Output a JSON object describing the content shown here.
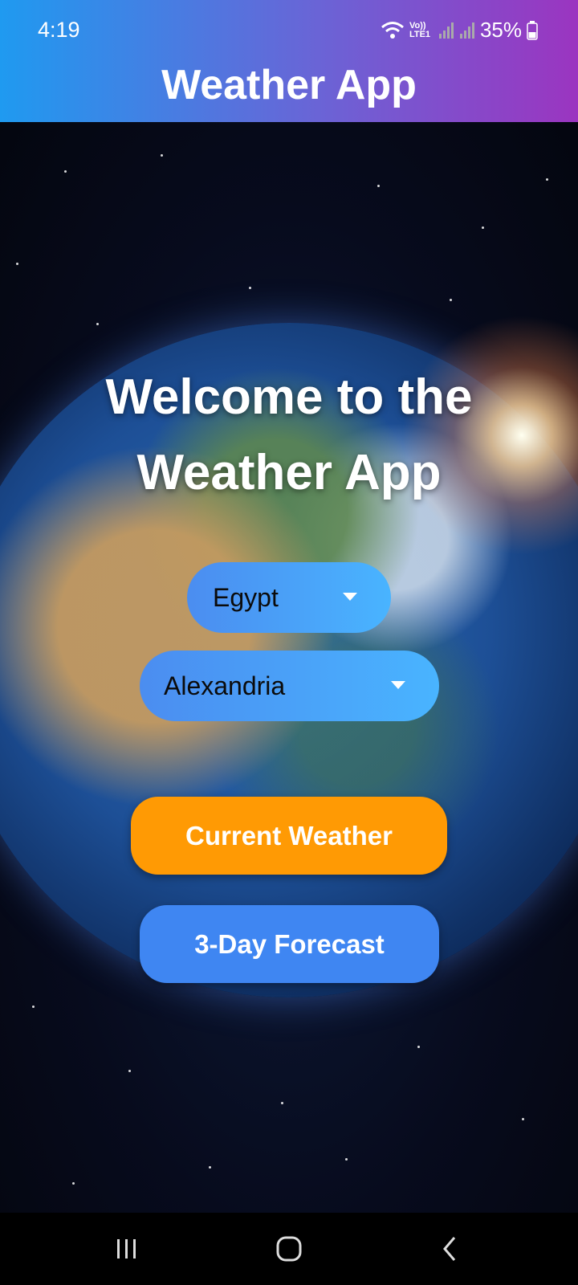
{
  "status_bar": {
    "time": "4:19",
    "battery": "35%",
    "network_label": "Vo)) LTE1"
  },
  "header": {
    "title": "Weather App",
    "gradient_start": "#1f9af0",
    "gradient_end": "#9b35c0"
  },
  "main": {
    "welcome_line1": "Welcome to the",
    "welcome_line2": "Weather App",
    "country_select": {
      "value": "Egypt",
      "icon": "chevron-down-icon"
    },
    "city_select": {
      "value": "Alexandria",
      "icon": "chevron-down-icon"
    },
    "current_weather_button": "Current Weather",
    "forecast_button": "3-Day Forecast",
    "colors": {
      "current_button": "#ff9a04",
      "forecast_button": "#3f86f2",
      "dropdown": "#49b4ff"
    }
  },
  "nav_bar": {
    "recent_icon": "recent-apps-icon",
    "home_icon": "home-icon",
    "back_icon": "back-icon"
  }
}
